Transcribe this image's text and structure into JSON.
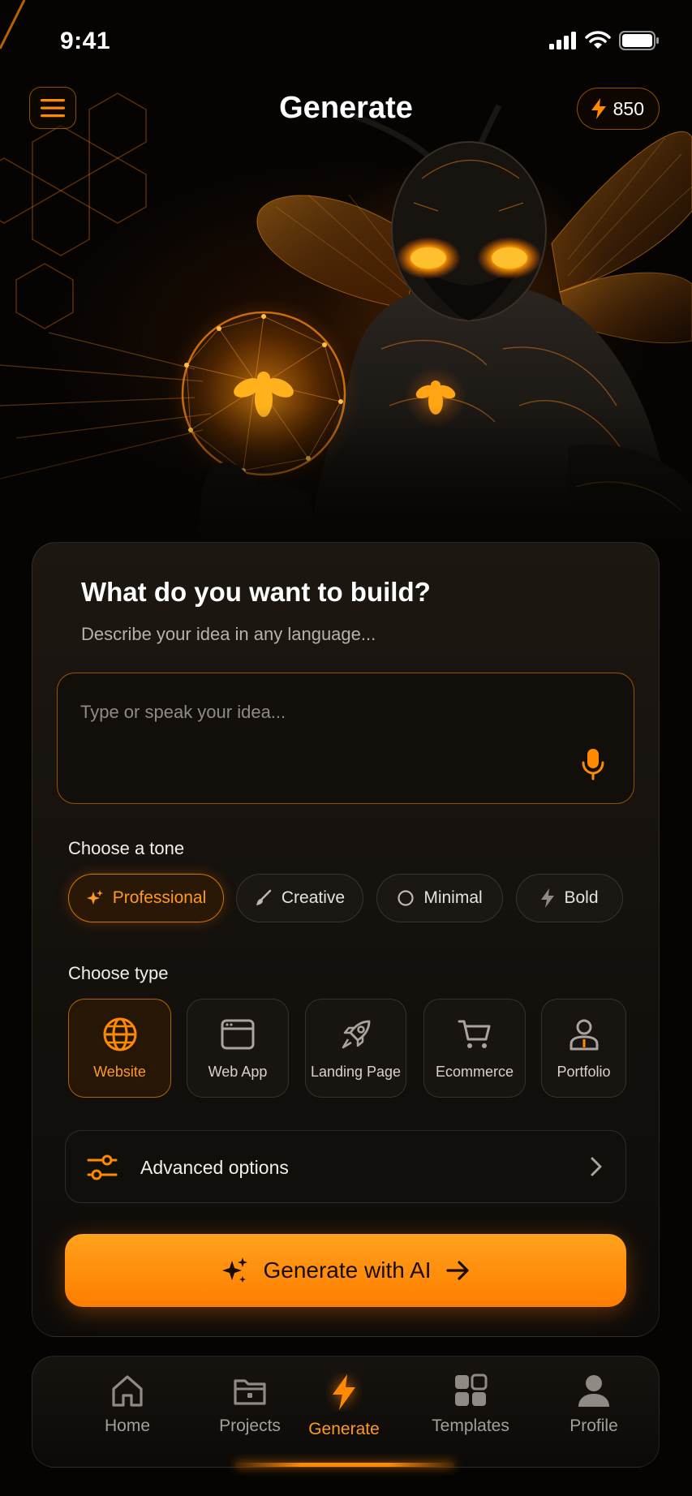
{
  "status_bar": {
    "time": "9:41",
    "icons": [
      "signal-icon",
      "wifi-icon",
      "battery-icon"
    ]
  },
  "header": {
    "title": "Generate",
    "credits": "850",
    "menu_icon": "hamburger-icon",
    "credits_icon": "bolt-icon"
  },
  "card": {
    "title": "What do you want to build?",
    "subtitle": "Describe your idea in any language...",
    "input": {
      "placeholder": "Type or speak your idea...",
      "value": ""
    },
    "tone": {
      "label": "Choose a tone",
      "options": [
        {
          "label": "Professional",
          "icon": "sparkle-icon",
          "selected": true
        },
        {
          "label": "Creative",
          "icon": "brush-icon",
          "selected": false
        },
        {
          "label": "Minimal",
          "icon": "circle-icon",
          "selected": false
        },
        {
          "label": "Bold",
          "icon": "bolt-icon",
          "selected": false
        }
      ]
    },
    "type": {
      "label": "Choose type",
      "options": [
        {
          "label": "Website",
          "icon": "globe-icon",
          "selected": true
        },
        {
          "label": "Web App",
          "icon": "browser-window-icon",
          "selected": false
        },
        {
          "label": "Landing Page",
          "icon": "rocket-icon",
          "selected": false
        },
        {
          "label": "Ecommerce",
          "icon": "cart-icon",
          "selected": false
        },
        {
          "label": "Portfolio",
          "icon": "person-badge-icon",
          "selected": false
        }
      ]
    },
    "advanced": {
      "label": "Advanced options"
    },
    "generate_button": {
      "label": "Generate with AI"
    }
  },
  "bottom_nav": {
    "items": [
      {
        "label": "Home",
        "icon": "home-icon",
        "active": false
      },
      {
        "label": "Projects",
        "icon": "folder-icon",
        "active": false
      },
      {
        "label": "Generate",
        "icon": "bolt-icon",
        "active": true
      },
      {
        "label": "Templates",
        "icon": "grid-icon",
        "active": false
      },
      {
        "label": "Profile",
        "icon": "user-icon",
        "active": false
      }
    ]
  },
  "colors": {
    "accent": "#ff8a00",
    "accent_text": "#ff9a1f",
    "background": "#050403"
  }
}
